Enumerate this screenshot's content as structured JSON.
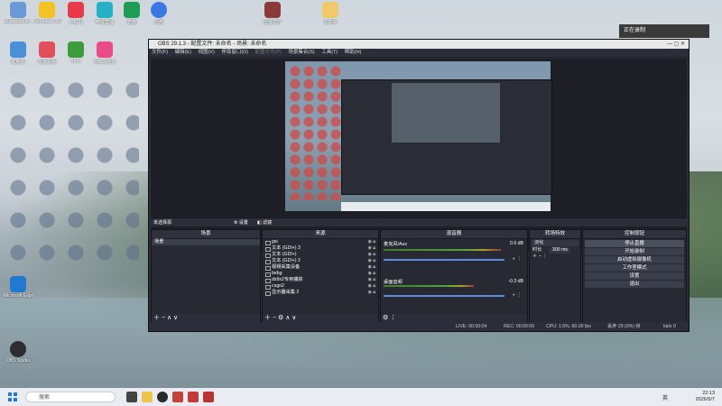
{
  "desktop": {
    "icons": [
      {
        "label": "Rubdeddesh..",
        "color": "#6a9ad6"
      },
      {
        "label": "PotPlayer 64 bit",
        "color": "#f3c323"
      },
      {
        "label": "小红书",
        "color": "#e93a4c"
      },
      {
        "label": "哔哩直播",
        "color": "#27b1c6"
      },
      {
        "label": "表格",
        "color": "#1f9d57"
      },
      {
        "label": "应用",
        "color": "#3b78e7"
      },
      {
        "label": "此电脑",
        "color": "#4a90d9"
      },
      {
        "label": "极速跳跳",
        "color": "#e34e5a"
      },
      {
        "label": "Xbox",
        "color": "#3c9c3c"
      },
      {
        "label": "Win10免费",
        "color": "#ec4b8a"
      },
      {
        "label": "Microsoft Edge",
        "color": "#2279d2"
      },
      {
        "label": "OBS Studio",
        "color": "#2d2d2d"
      }
    ],
    "top_icons": [
      {
        "label": "压缩文件",
        "color": "#8b3a3a"
      },
      {
        "label": "文件夹",
        "color": "#f0c96b"
      }
    ]
  },
  "popup": {
    "text": "正在录制"
  },
  "obs": {
    "title": "OBS 29.1.3 - 配置文件: 未命名 - 场景: 未命名",
    "window_controls": "—  ▢  ✕",
    "menu": [
      "文件(F)",
      "编辑(E)",
      "视图(V)",
      "停靠窗口(D)",
      "配置文件(P)",
      "场景集合(S)",
      "工具(T)",
      "帮助(H)"
    ],
    "context_bar": {
      "label": "未选择源",
      "properties": "设置",
      "filters": "滤镜"
    },
    "scenes": {
      "title": "场景",
      "items": [
        "场景"
      ],
      "footer": "＋ −   ∧ ∨"
    },
    "sources": {
      "title": "来源",
      "items": [
        "gsi",
        "文本 (GDI+) 3",
        "文本 (GDI+)",
        "文本 (GDI+) 2",
        "视频采集设备",
        "bebg",
        "dx9x2专用捕获",
        "csgo2",
        "显示器采集 2"
      ],
      "footer": "＋ −  ⚙  ∧ ∨"
    },
    "mixer": {
      "title": "混音器",
      "channels": [
        {
          "name": "麦克风/Aux",
          "db": "0.0 dB"
        },
        {
          "name": "桌面音频",
          "db": "-0.3 dB"
        }
      ],
      "footer": "⚙ ⋮"
    },
    "transitions": {
      "title": "转场特效",
      "type": "淡化",
      "duration_label": "时长",
      "duration": "300 ms",
      "footer": "＋ − ⋮"
    },
    "controls": {
      "title": "控制按钮",
      "buttons": [
        "停止直播",
        "开始录制",
        "启动虚拟摄像机",
        "工作室模式",
        "设置",
        "退出"
      ]
    },
    "status": {
      "live": "LIVE: 00:00:04",
      "rec": "REC: 00:00:00",
      "cpu": "CPU: 1.6%, 60.00 fps",
      "dropped": "丢弃 29 (0%) 帧",
      "kbps": "kb/s 0"
    }
  },
  "taskbar": {
    "search": "搜索",
    "time": "22:13",
    "date": "2026/5/7",
    "lang": "英"
  },
  "colors": {
    "obs_bg": "#2b2e38",
    "accent": "#5a8de0"
  }
}
